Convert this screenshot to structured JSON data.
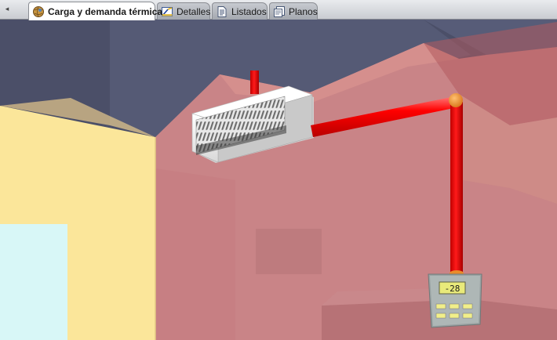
{
  "tabs": [
    {
      "label": "Carga y demanda térmica",
      "icon": "globe-icon",
      "active": true
    },
    {
      "label": "Detalles",
      "icon": "ruler-detail-icon",
      "active": false
    },
    {
      "label": "Listados",
      "icon": "document-icon",
      "active": false
    },
    {
      "label": "Planos",
      "icon": "plan-sheet-icon",
      "active": false
    }
  ],
  "scroll_left": "◂",
  "thermostat": {
    "display": "-28"
  },
  "colors": {
    "pipe": "#ff0000",
    "joint": "#f08a20",
    "wall_left": "#fbe69a",
    "wall_back": "#c98487",
    "ceiling": "#4b4f68",
    "window": "#d8f7f7",
    "unit_body": "#f2f2f2",
    "thermostat_screen": "#e9ea7a"
  }
}
